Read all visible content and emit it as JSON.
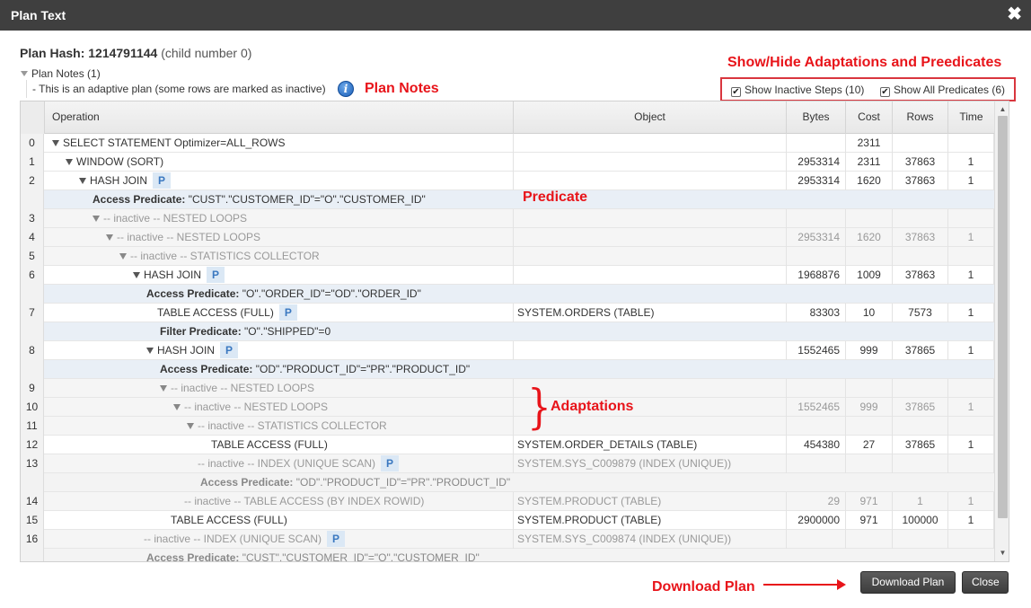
{
  "dialog": {
    "title": "Plan Text",
    "close_glyph": "✖"
  },
  "plan": {
    "hash_label": "Plan Hash:",
    "hash_value": "1214791144",
    "child": "(child number 0)"
  },
  "notes": {
    "header": "Plan Notes (1)",
    "text": "- This is an adaptive plan (some rows are marked as inactive)",
    "info_glyph": "i"
  },
  "annotations": {
    "show_hide": "Show/Hide Adaptations and Preedicates",
    "plan_notes": "Plan Notes",
    "predicate": "Predicate",
    "adaptations": "Adaptations",
    "download_plan": "Download Plan",
    "brace": "}"
  },
  "options": {
    "inactive_label": "Show Inactive Steps (10)",
    "predicates_label": "Show All Predicates (6)",
    "check_glyph": "✔"
  },
  "table": {
    "columns": [
      "Operation",
      "Object",
      "Bytes",
      "Cost",
      "Rows",
      "Time"
    ],
    "rows": [
      {
        "id": "0",
        "op": "SELECT STATEMENT Optimizer=ALL_ROWS",
        "level": 0,
        "tri": true,
        "p": false,
        "inactive": false,
        "object": "",
        "bytes": "",
        "cost": "2311",
        "rows": "",
        "time": ""
      },
      {
        "id": "1",
        "op": "WINDOW (SORT)",
        "level": 1,
        "tri": true,
        "p": false,
        "inactive": false,
        "object": "",
        "bytes": "2953314",
        "cost": "2311",
        "rows": "37863",
        "time": "1"
      },
      {
        "id": "2",
        "op": "HASH JOIN",
        "level": 2,
        "tri": true,
        "p": true,
        "inactive": false,
        "object": "",
        "bytes": "2953314",
        "cost": "1620",
        "rows": "37863",
        "time": "1"
      },
      {
        "pred": true,
        "label": "Access Predicate:",
        "text": "\"CUST\".\"CUSTOMER_ID\"=\"O\".\"CUSTOMER_ID\"",
        "level": 3,
        "inactive": false
      },
      {
        "id": "3",
        "op": "-- inactive -- NESTED LOOPS",
        "level": 3,
        "tri": true,
        "p": false,
        "inactive": true,
        "object": "",
        "bytes": "",
        "cost": "",
        "rows": "",
        "time": ""
      },
      {
        "id": "4",
        "op": "-- inactive -- NESTED LOOPS",
        "level": 4,
        "tri": true,
        "p": false,
        "inactive": true,
        "object": "",
        "bytes": "2953314",
        "cost": "1620",
        "rows": "37863",
        "time": "1"
      },
      {
        "id": "5",
        "op": "-- inactive -- STATISTICS COLLECTOR",
        "level": 5,
        "tri": true,
        "p": false,
        "inactive": true,
        "object": "",
        "bytes": "",
        "cost": "",
        "rows": "",
        "time": ""
      },
      {
        "id": "6",
        "op": "HASH JOIN",
        "level": 6,
        "tri": true,
        "p": true,
        "inactive": false,
        "object": "",
        "bytes": "1968876",
        "cost": "1009",
        "rows": "37863",
        "time": "1"
      },
      {
        "pred": true,
        "label": "Access Predicate:",
        "text": "\"O\".\"ORDER_ID\"=\"OD\".\"ORDER_ID\"",
        "level": 7,
        "inactive": false
      },
      {
        "id": "7",
        "op": "TABLE ACCESS (FULL)",
        "level": 7,
        "tri": false,
        "p": true,
        "inactive": false,
        "object": "SYSTEM.ORDERS (TABLE)",
        "bytes": "83303",
        "cost": "10",
        "rows": "7573",
        "time": "1"
      },
      {
        "pred": true,
        "label": "Filter Predicate:",
        "text": "\"O\".\"SHIPPED\"=0",
        "level": 8,
        "inactive": false
      },
      {
        "id": "8",
        "op": "HASH JOIN",
        "level": 7,
        "tri": true,
        "p": true,
        "inactive": false,
        "object": "",
        "bytes": "1552465",
        "cost": "999",
        "rows": "37865",
        "time": "1"
      },
      {
        "pred": true,
        "label": "Access Predicate:",
        "text": "\"OD\".\"PRODUCT_ID\"=\"PR\".\"PRODUCT_ID\"",
        "level": 8,
        "inactive": false
      },
      {
        "id": "9",
        "op": "-- inactive -- NESTED LOOPS",
        "level": 8,
        "tri": true,
        "p": false,
        "inactive": true,
        "object": "",
        "bytes": "",
        "cost": "",
        "rows": "",
        "time": ""
      },
      {
        "id": "10",
        "op": "-- inactive -- NESTED LOOPS",
        "level": 9,
        "tri": true,
        "p": false,
        "inactive": true,
        "object": "",
        "bytes": "1552465",
        "cost": "999",
        "rows": "37865",
        "time": "1"
      },
      {
        "id": "11",
        "op": "-- inactive -- STATISTICS COLLECTOR",
        "level": 10,
        "tri": true,
        "p": false,
        "inactive": true,
        "object": "",
        "bytes": "",
        "cost": "",
        "rows": "",
        "time": ""
      },
      {
        "id": "12",
        "op": "TABLE ACCESS (FULL)",
        "level": 11,
        "tri": false,
        "p": false,
        "inactive": false,
        "object": "SYSTEM.ORDER_DETAILS (TABLE)",
        "bytes": "454380",
        "cost": "27",
        "rows": "37865",
        "time": "1"
      },
      {
        "id": "13",
        "op": "-- inactive -- INDEX (UNIQUE SCAN)",
        "level": 10,
        "tri": false,
        "p": true,
        "inactive": true,
        "object": "SYSTEM.SYS_C009879 (INDEX (UNIQUE))",
        "bytes": "",
        "cost": "",
        "rows": "",
        "time": ""
      },
      {
        "pred": true,
        "label": "Access Predicate:",
        "text": "\"OD\".\"PRODUCT_ID\"=\"PR\".\"PRODUCT_ID\"",
        "level": 11,
        "inactive": true
      },
      {
        "id": "14",
        "op": "-- inactive -- TABLE ACCESS (BY INDEX ROWID)",
        "level": 9,
        "tri": false,
        "p": false,
        "inactive": true,
        "object": "SYSTEM.PRODUCT (TABLE)",
        "bytes": "29",
        "cost": "971",
        "rows": "1",
        "time": "1"
      },
      {
        "id": "15",
        "op": "TABLE ACCESS (FULL)",
        "level": 8,
        "tri": false,
        "p": false,
        "inactive": false,
        "object": "SYSTEM.PRODUCT (TABLE)",
        "bytes": "2900000",
        "cost": "971",
        "rows": "100000",
        "time": "1"
      },
      {
        "id": "16",
        "op": "-- inactive -- INDEX (UNIQUE SCAN)",
        "level": 6,
        "tri": false,
        "p": true,
        "inactive": true,
        "object": "SYSTEM.SYS_C009874 (INDEX (UNIQUE))",
        "bytes": "",
        "cost": "",
        "rows": "",
        "time": ""
      },
      {
        "pred": true,
        "label": "Access Predicate:",
        "text": "\"CUST\".\"CUSTOMER_ID\"=\"O\".\"CUSTOMER_ID\"",
        "level": 7,
        "inactive": true
      }
    ]
  },
  "buttons": {
    "download": "Download Plan",
    "close": "Close"
  },
  "colors": {
    "titlebar": "#3f3f3f",
    "annotation": "#e8141a",
    "predicate_bg": "#e9eff6",
    "badge": "#3a78c0"
  }
}
